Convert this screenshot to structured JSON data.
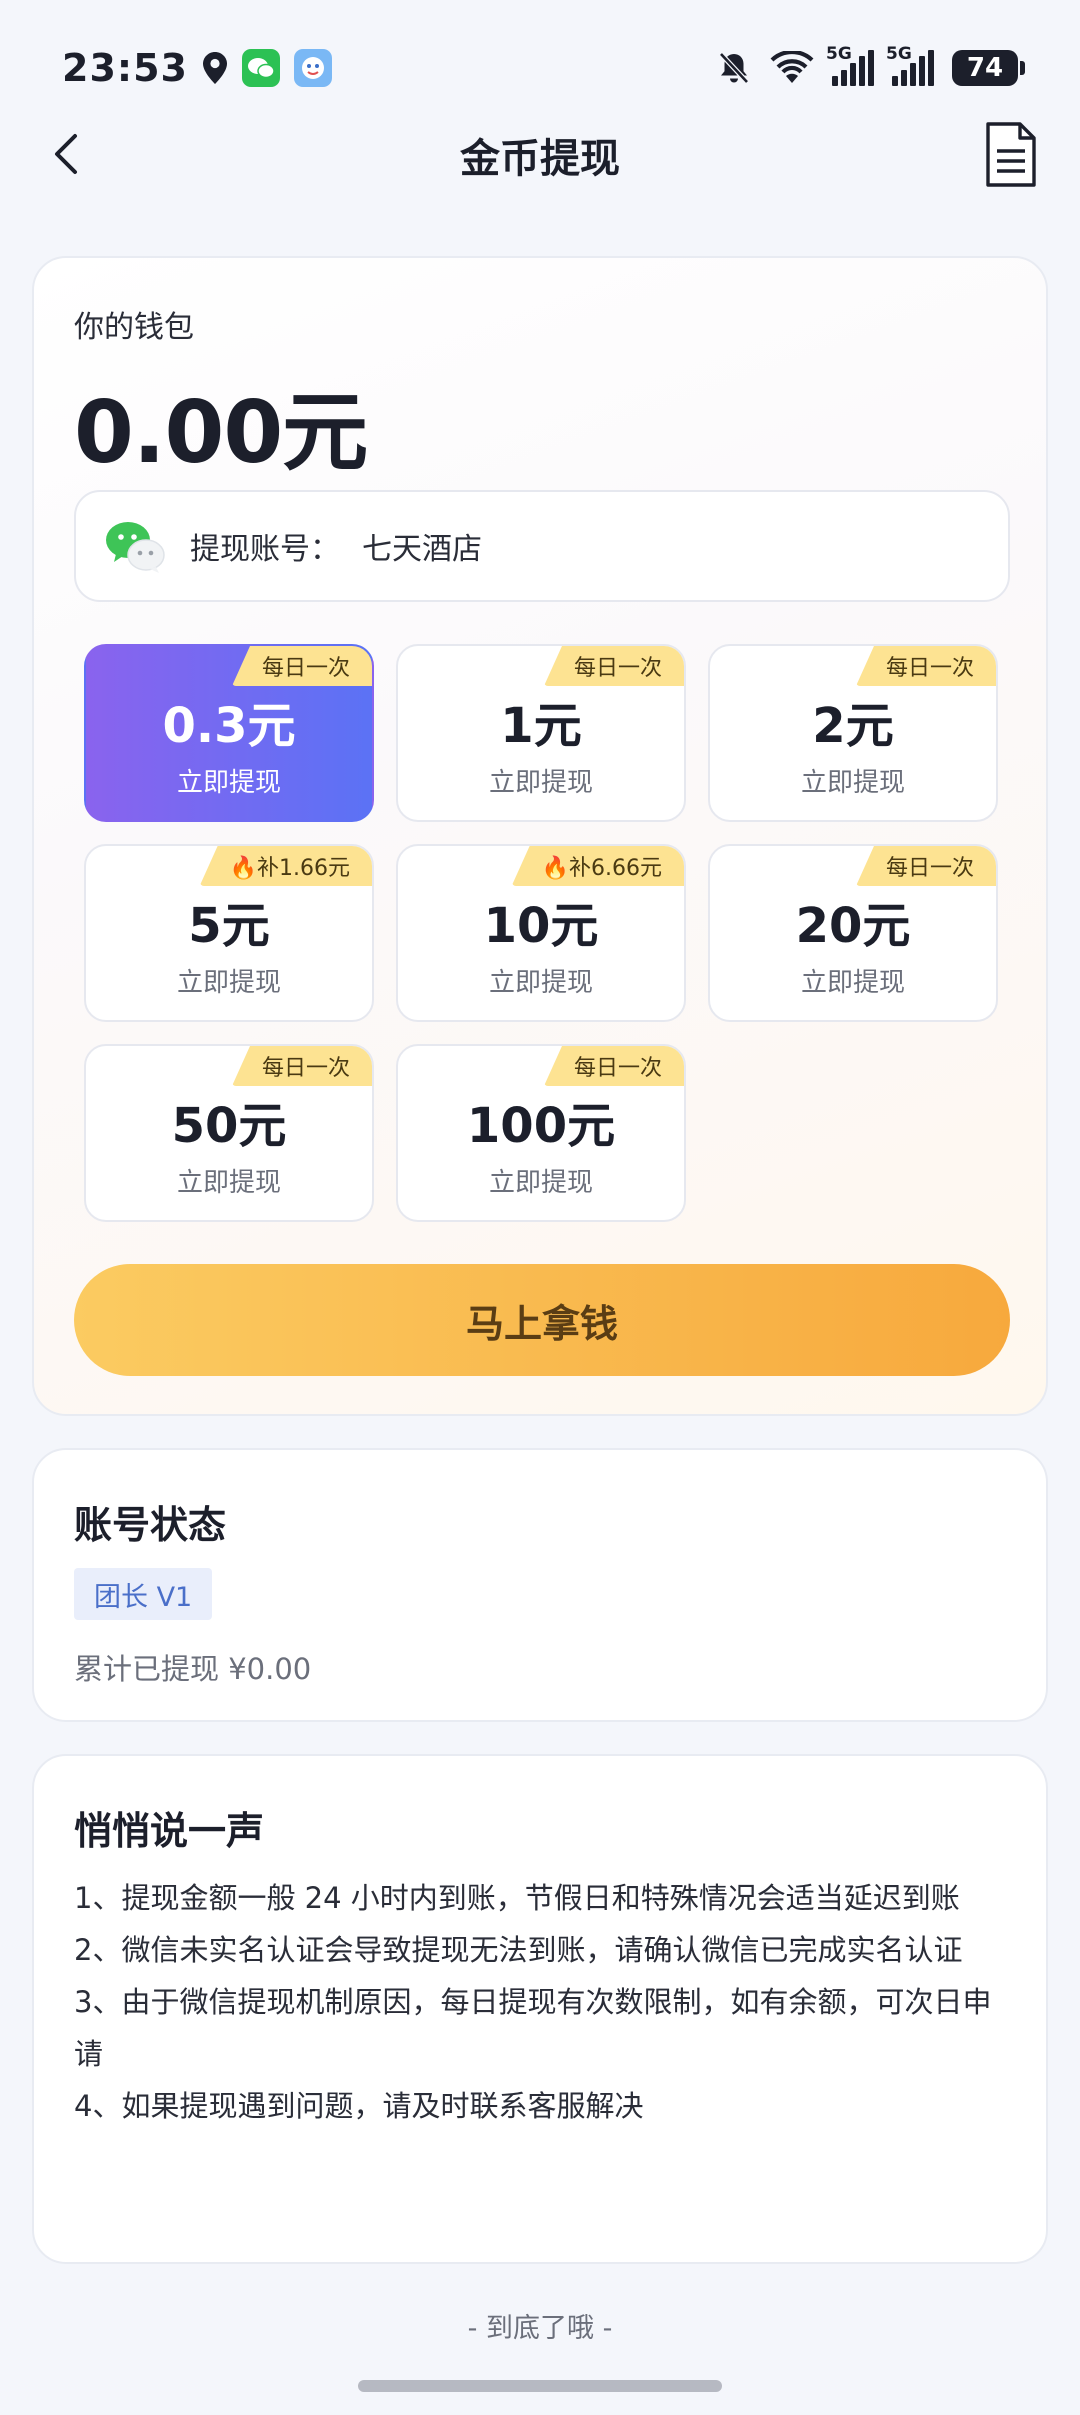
{
  "status_bar": {
    "time": "23:53",
    "signal1_tag": "5G",
    "signal2_tag": "5G",
    "battery": "74"
  },
  "nav": {
    "title": "金币提现"
  },
  "wallet": {
    "label": "你的钱包",
    "balance": "0.00元",
    "account_label": "提现账号：",
    "account_value": "七天酒店"
  },
  "options": [
    {
      "amount": "0.3元",
      "action": "立即提现",
      "badge": "每日一次"
    },
    {
      "amount": "1元",
      "action": "立即提现",
      "badge": "每日一次"
    },
    {
      "amount": "2元",
      "action": "立即提现",
      "badge": "每日一次"
    },
    {
      "amount": "5元",
      "action": "立即提现",
      "badge": "🔥补1.66元"
    },
    {
      "amount": "10元",
      "action": "立即提现",
      "badge": "🔥补6.66元"
    },
    {
      "amount": "20元",
      "action": "立即提现",
      "badge": "每日一次"
    },
    {
      "amount": "50元",
      "action": "立即提现",
      "badge": "每日一次"
    },
    {
      "amount": "100元",
      "action": "立即提现",
      "badge": "每日一次"
    }
  ],
  "cta_label": "马上拿钱",
  "account_status": {
    "title": "账号状态",
    "level": "团长 V1",
    "total": "累计已提现 ¥0.00"
  },
  "notes": {
    "title": "悄悄说一声",
    "items": [
      "1、提现金额一般 24 小时内到账，节假日和特殊情况会适当延迟到账",
      "2、微信未实名认证会导致提现无法到账，请确认微信已完成实名认证",
      "3、由于微信提现机制原因，每日提现有次数限制，如有余额，可次日申请",
      "4、如果提现遇到问题，请及时联系客服解决"
    ]
  },
  "footer": "- 到底了哦 -",
  "colors": {
    "accent_purple": "#8a63ee",
    "accent_blue": "#5b72f5",
    "cta_gold": "#f7a93d",
    "badge_yellow": "#fde392"
  }
}
